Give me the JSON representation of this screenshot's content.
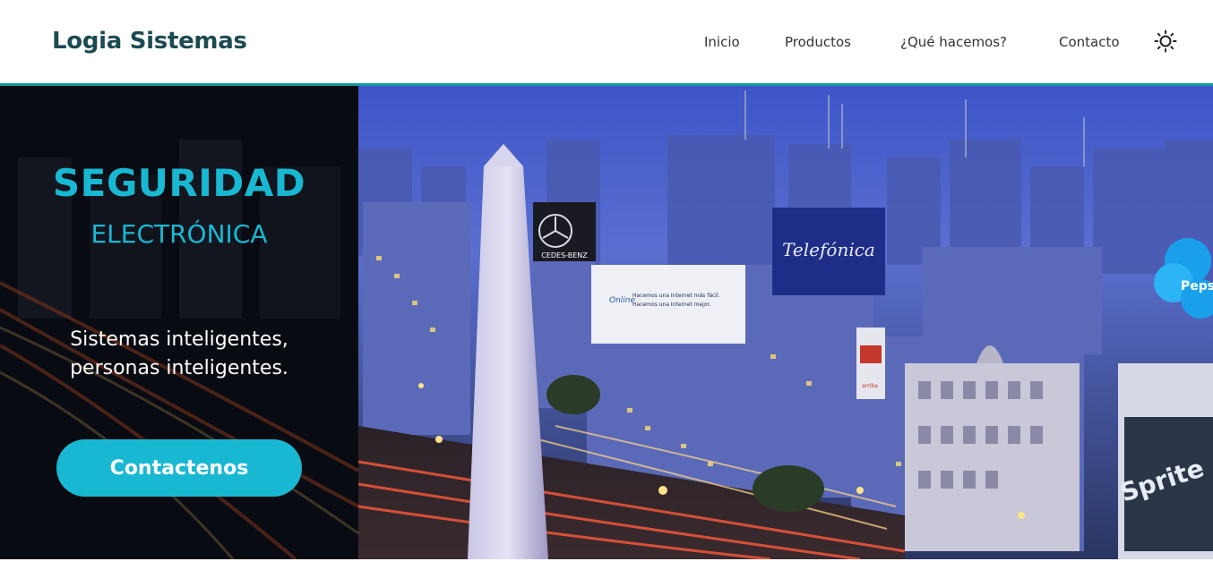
{
  "header": {
    "brand": "Logia Sistemas",
    "nav": [
      {
        "label": "Inicio"
      },
      {
        "label": "Productos"
      },
      {
        "label": "¿Qué hacemos?"
      },
      {
        "label": "Contacto"
      }
    ],
    "theme_toggle_icon": "sun-icon"
  },
  "hero": {
    "title": "SEGURIDAD",
    "subtitle": "ELECTRÓNICA",
    "tagline_line1": "Sistemas inteligentes,",
    "tagline_line2": "personas inteligentes.",
    "cta_label": "Contactenos",
    "image": {
      "billboard_brand": "Telefónica",
      "billboard_text_line1": "Hacemos una Internet más fácil.",
      "billboard_text_line2": "Hacemos una Internet mejor.",
      "billboard_logo_text": "Online",
      "sign_mercedes": "CEDES-BENZ",
      "sign_sprite": "Sprite",
      "sign_arriba": "arriba",
      "sign_pepsi": "Pepsi"
    }
  },
  "colors": {
    "brand": "#1c4a52",
    "accent": "#19b8d2",
    "divider": "#0e9aa0",
    "panel": "#0d1220"
  }
}
